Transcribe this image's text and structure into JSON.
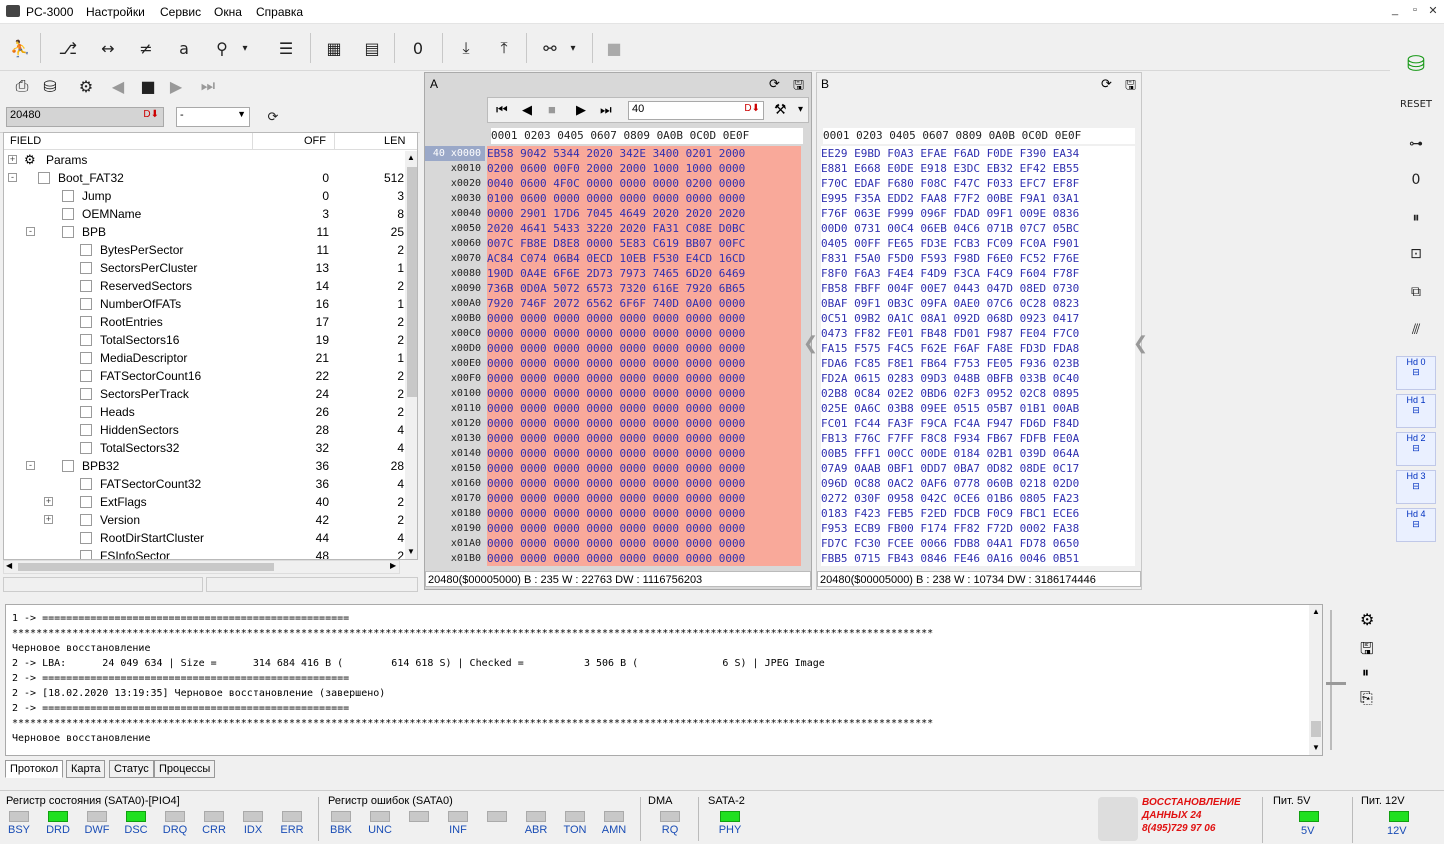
{
  "app": {
    "title": "PC-3000",
    "menu": [
      "Настройки",
      "Сервис",
      "Окна",
      "Справка"
    ]
  },
  "left": {
    "lba_value": "20480",
    "combo_value": "-",
    "tree_headers": {
      "field": "FIELD",
      "off": "OFF",
      "len": "LEN"
    },
    "rows": [
      {
        "name": "Params",
        "off": "",
        "len": "",
        "lvl": 0,
        "exp": "+",
        "icon": true
      },
      {
        "name": "Boot_FAT32",
        "off": "0",
        "len": "512",
        "lvl": 0,
        "exp": "-"
      },
      {
        "name": "Jump",
        "off": "0",
        "len": "3",
        "lvl": 1
      },
      {
        "name": "OEMName",
        "off": "3",
        "len": "8",
        "lvl": 1
      },
      {
        "name": "BPB",
        "off": "11",
        "len": "25",
        "lvl": 1,
        "exp": "-"
      },
      {
        "name": "BytesPerSector",
        "off": "11",
        "len": "2",
        "lvl": 2
      },
      {
        "name": "SectorsPerCluster",
        "off": "13",
        "len": "1",
        "lvl": 2
      },
      {
        "name": "ReservedSectors",
        "off": "14",
        "len": "2",
        "lvl": 2
      },
      {
        "name": "NumberOfFATs",
        "off": "16",
        "len": "1",
        "lvl": 2
      },
      {
        "name": "RootEntries",
        "off": "17",
        "len": "2",
        "lvl": 2
      },
      {
        "name": "TotalSectors16",
        "off": "19",
        "len": "2",
        "lvl": 2
      },
      {
        "name": "MediaDescriptor",
        "off": "21",
        "len": "1",
        "lvl": 2
      },
      {
        "name": "FATSectorCount16",
        "off": "22",
        "len": "2",
        "lvl": 2
      },
      {
        "name": "SectorsPerTrack",
        "off": "24",
        "len": "2",
        "lvl": 2
      },
      {
        "name": "Heads",
        "off": "26",
        "len": "2",
        "lvl": 2
      },
      {
        "name": "HiddenSectors",
        "off": "28",
        "len": "4",
        "lvl": 2
      },
      {
        "name": "TotalSectors32",
        "off": "32",
        "len": "4",
        "lvl": 2
      },
      {
        "name": "BPB32",
        "off": "36",
        "len": "28",
        "lvl": 1,
        "exp": "-"
      },
      {
        "name": "FATSectorCount32",
        "off": "36",
        "len": "4",
        "lvl": 2
      },
      {
        "name": "ExtFlags",
        "off": "40",
        "len": "2",
        "lvl": 2,
        "exp": "+"
      },
      {
        "name": "Version",
        "off": "42",
        "len": "2",
        "lvl": 2,
        "exp": "+"
      },
      {
        "name": "RootDirStartCluster",
        "off": "44",
        "len": "4",
        "lvl": 2
      },
      {
        "name": "FSInfoSector",
        "off": "48",
        "len": "2",
        "lvl": 2
      }
    ]
  },
  "panelA": {
    "label": "A",
    "goto_value": "40",
    "hdr": "0001 0203 0405 0607 0809 0A0B 0C0D 0E0F",
    "addrs": [
      "40 x0000",
      "x0010",
      "x0020",
      "x0030",
      "x0040",
      "x0050",
      "x0060",
      "x0070",
      "x0080",
      "x0090",
      "x00A0",
      "x00B0",
      "x00C0",
      "x00D0",
      "x00E0",
      "x00F0",
      "x0100",
      "x0110",
      "x0120",
      "x0130",
      "x0140",
      "x0150",
      "x0160",
      "x0170",
      "x0180",
      "x0190",
      "x01A0",
      "x01B0"
    ],
    "lines": [
      "EB58 9042 5344 2020 342E 3400 0201 2000",
      "0200 0600 00F0 2000 2000 1000 1000 0000",
      "0040 0600 4F0C 0000 0000 0000 0200 0000",
      "0100 0600 0000 0000 0000 0000 0000 0000",
      "0000 2901 17D6 7045 4649 2020 2020 2020",
      "2020 4641 5433 3220 2020 FA31 C08E D0BC",
      "007C FB8E D8E8 0000 5E83 C619 BB07 00FC",
      "AC84 C074 06B4 0ECD 10EB F530 E4CD 16CD",
      "190D 0A4E 6F6E 2D73 7973 7465 6D20 6469",
      "736B 0D0A 5072 6573 7320 616E 7920 6B65",
      "7920 746F 2072 6562 6F6F 740D 0A00 0000",
      "0000 0000 0000 0000 0000 0000 0000 0000",
      "0000 0000 0000 0000 0000 0000 0000 0000",
      "0000 0000 0000 0000 0000 0000 0000 0000",
      "0000 0000 0000 0000 0000 0000 0000 0000",
      "0000 0000 0000 0000 0000 0000 0000 0000",
      "0000 0000 0000 0000 0000 0000 0000 0000",
      "0000 0000 0000 0000 0000 0000 0000 0000",
      "0000 0000 0000 0000 0000 0000 0000 0000",
      "0000 0000 0000 0000 0000 0000 0000 0000",
      "0000 0000 0000 0000 0000 0000 0000 0000",
      "0000 0000 0000 0000 0000 0000 0000 0000",
      "0000 0000 0000 0000 0000 0000 0000 0000",
      "0000 0000 0000 0000 0000 0000 0000 0000",
      "0000 0000 0000 0000 0000 0000 0000 0000",
      "0000 0000 0000 0000 0000 0000 0000 0000",
      "0000 0000 0000 0000 0000 0000 0000 0000",
      "0000 0000 0000 0000 0000 0000 0000 0000"
    ],
    "status": "20480($00005000) B : 235 W : 22763 DW : 1116756203"
  },
  "panelB": {
    "label": "B",
    "hdr": "0001 0203 0405 0607 0809 0A0B 0C0D 0E0F",
    "lines": [
      "EE29 E9BD F0A3 EFAE F6AD F0DE F390 EA34",
      "E881 E668 E0DE E918 E3DC EB32 EF42 EB55",
      "F70C EDAF F680 F08C F47C F033 EFC7 EF8F",
      "E995 F35A EDD2 FAA8 F7F2 00BE F9A1 03A1",
      "F76F 063E F999 096F FDAD 09F1 009E 0836",
      "00D0 0731 00C4 06EB 04C6 071B 07C7 05BC",
      "0405 00FF FE65 FD3E FCB3 FC09 FC0A F901",
      "F831 F5A0 F5D0 F593 F98D F6E0 FC52 F76E",
      "F8F0 F6A3 F4E4 F4D9 F3CA F4C9 F604 F78F",
      "FB58 FBFF 004F 00E7 0443 047D 08ED 0730",
      "0BAF 09F1 0B3C 09FA 0AE0 07C6 0C28 0823",
      "0C51 09B2 0A1C 08A1 092D 068D 0923 0417",
      "0473 FF82 FE01 FB48 FD01 F987 FE04 F7C0",
      "FA15 F575 F4C5 F62E F6AF FA8E FD3D FDA8",
      "FDA6 FC85 F8E1 FB64 F753 FE05 F936 023B",
      "FD2A 0615 0283 09D3 048B 0BFB 033B 0C40",
      "02B8 0C84 02E2 0BD6 02F3 0952 02C8 0895",
      "025E 0A6C 03B8 09EE 0515 05B7 01B1 00AB",
      "FC01 FC44 FA3F F9CA FC4A F947 FD6D F84D",
      "FB13 F76C F7FF F8C8 F934 FB67 FDFB FE0A",
      "00B5 FFF1 00CC 00DE 0184 02B1 039D 064A",
      "07A9 0AAB 0BF1 0DD7 0BA7 0D82 08DE 0C17",
      "096D 0C88 0AC2 0AF6 0778 060B 0218 02D0",
      "0272 030F 0958 042C 0CE6 01B6 0805 FA23",
      "0183 F423 FEB5 F2ED FDCB F0C9 FBC1 ECE6",
      "F953 ECB9 FB00 F174 FF82 F72D 0002 FA38",
      "FD7C FC30 FCEE 0066 FDB8 04A1 FD78 0650",
      "FBB5 0715 FB43 0846 FE46 0A16 0046 0B51"
    ],
    "status": "20480($00005000) B : 238 W : 10734 DW : 3186174446"
  },
  "log": {
    "lines": [
      "1 -> ===================================================",
      "*********************************************************************************************************************************************************",
      "Черновое восстановление",
      "2 -> LBA:      24 049 634 | Size =      314 684 416 B (        614 618 S) | Checked =          3 506 B (              6 S) | JPEG Image",
      "2 -> ===================================================",
      "2 -> [18.02.2020 13:19:35] Черновое восстановление (завершено)",
      "2 -> ===================================================",
      "*********************************************************************************************************************************************************",
      "Черновое восстановление"
    ],
    "tabs": [
      "Протокол",
      "Карта",
      "Статус",
      "Процессы"
    ]
  },
  "bottom": {
    "status_reg": "Регистр состояния (SATA0)-[PIO4]",
    "status_leds": [
      {
        "l": "BSY",
        "on": false
      },
      {
        "l": "DRD",
        "on": true
      },
      {
        "l": "DWF",
        "on": false
      },
      {
        "l": "DSC",
        "on": true
      },
      {
        "l": "DRQ",
        "on": false
      },
      {
        "l": "CRR",
        "on": false
      },
      {
        "l": "IDX",
        "on": false
      },
      {
        "l": "ERR",
        "on": false
      }
    ],
    "error_reg": "Регистр ошибок  (SATA0)",
    "error_leds": [
      {
        "l": "BBK",
        "on": false
      },
      {
        "l": "UNC",
        "on": false
      },
      {
        "l": "",
        "on": false
      },
      {
        "l": "INF",
        "on": false
      },
      {
        "l": "",
        "on": false
      },
      {
        "l": "ABR",
        "on": false
      },
      {
        "l": "TON",
        "on": false
      },
      {
        "l": "AMN",
        "on": false
      }
    ],
    "dma": "DMA",
    "rq": "RQ",
    "sata": "SATA-2",
    "phy": "PHY",
    "logo": [
      "ВОССТАНОВЛЕНИЕ",
      "ДАННЫХ  24",
      "8(495)729 97 06"
    ],
    "pit5": "Пит. 5V",
    "v5": "5V",
    "pit12": "Пит. 12V",
    "v12": "12V"
  },
  "right": {
    "hd": [
      "Hd 0",
      "Hd 1",
      "Hd 2",
      "Hd 3",
      "Hd 4"
    ]
  },
  "colors": {
    "hex_bg": "#f9a99a",
    "hex_text": "#3030b0",
    "led_on": "#20e020",
    "logo_red": "#e01010"
  }
}
